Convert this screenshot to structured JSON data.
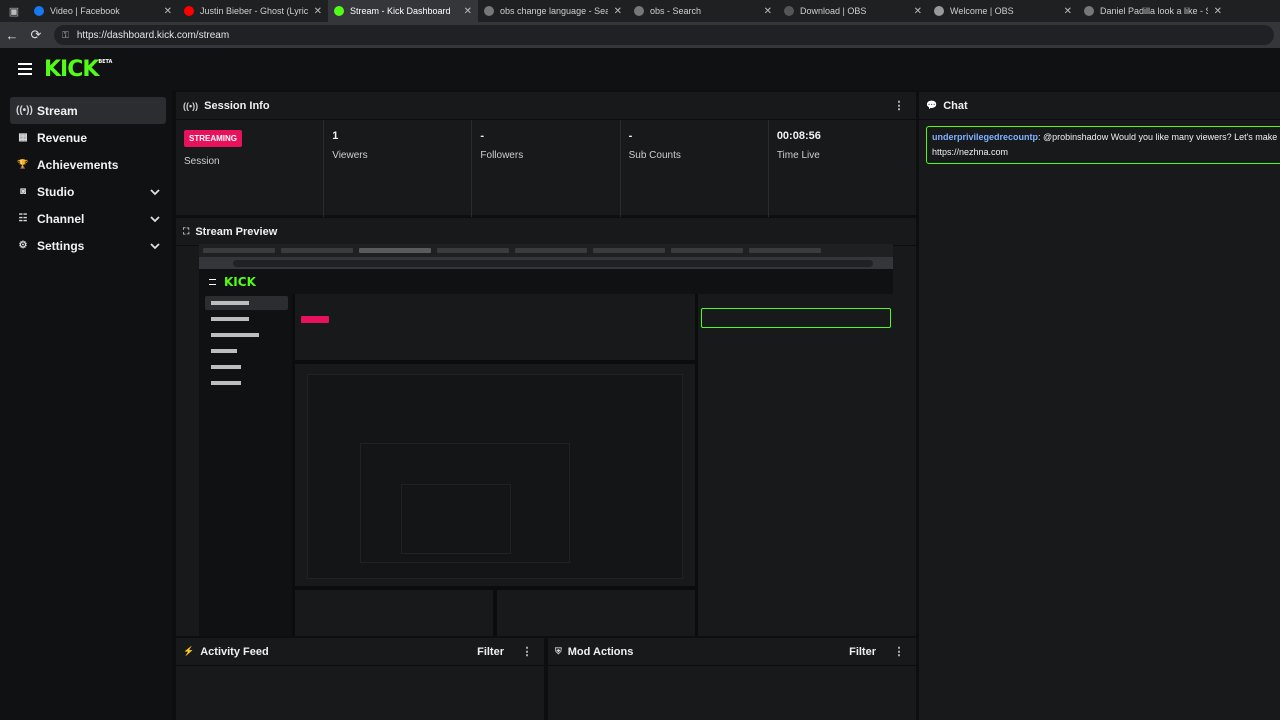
{
  "browser": {
    "tabs": [
      {
        "title": "Video | Facebook",
        "favicon": "facebook-icon",
        "color": "#1877f2",
        "active": false
      },
      {
        "title": "Justin Bieber - Ghost (Lyrics)",
        "favicon": "youtube-icon",
        "color": "#ff0000",
        "active": false
      },
      {
        "title": "Stream - Kick Dashboard",
        "favicon": "kick-icon",
        "color": "#53fc18",
        "active": true
      },
      {
        "title": "obs change language - Search",
        "favicon": "search-icon",
        "color": "#777777",
        "active": false
      },
      {
        "title": "obs - Search",
        "favicon": "search-icon",
        "color": "#777777",
        "active": false
      },
      {
        "title": "Download | OBS",
        "favicon": "obs-icon",
        "color": "#555555",
        "active": false
      },
      {
        "title": "Welcome | OBS",
        "favicon": "globe-icon",
        "color": "#999999",
        "active": false
      },
      {
        "title": "Daniel Padilla look a like - Search",
        "favicon": "search-icon",
        "color": "#777777",
        "active": false
      }
    ],
    "url": "https://dashboard.kick.com/stream"
  },
  "brand": {
    "logo": "KICK",
    "beta": "BETA",
    "accent": "#53fc18"
  },
  "sidebar": {
    "items": [
      {
        "label": "Stream",
        "icon": "broadcast-icon",
        "active": true,
        "expandable": false
      },
      {
        "label": "Revenue",
        "icon": "bar-chart-icon",
        "active": false,
        "expandable": false
      },
      {
        "label": "Achievements",
        "icon": "trophy-icon",
        "active": false,
        "expandable": false
      },
      {
        "label": "Studio",
        "icon": "studio-icon",
        "active": false,
        "expandable": true
      },
      {
        "label": "Channel",
        "icon": "channel-icon",
        "active": false,
        "expandable": true
      },
      {
        "label": "Settings",
        "icon": "gear-icon",
        "active": false,
        "expandable": true
      }
    ]
  },
  "session": {
    "title": "Session Info",
    "status_badge": "STREAMING",
    "status_color": "#e8115d",
    "stats": [
      {
        "value": "",
        "caption": "Session"
      },
      {
        "value": "1",
        "caption": "Viewers"
      },
      {
        "value": "-",
        "caption": "Followers"
      },
      {
        "value": "-",
        "caption": "Sub Counts"
      },
      {
        "value": "00:08:56",
        "caption": "Time Live"
      }
    ]
  },
  "chat": {
    "title": "Chat",
    "messages": [
      {
        "user": "underprivilegedrecountp",
        "text": ": @probinshadow Would you like many viewers? Let's make",
        "text2": "https://nezhna.com"
      }
    ]
  },
  "preview": {
    "title": "Stream Preview"
  },
  "activity": {
    "title": "Activity Feed",
    "filter": "Filter"
  },
  "mod": {
    "title": "Mod Actions",
    "filter": "Filter"
  }
}
